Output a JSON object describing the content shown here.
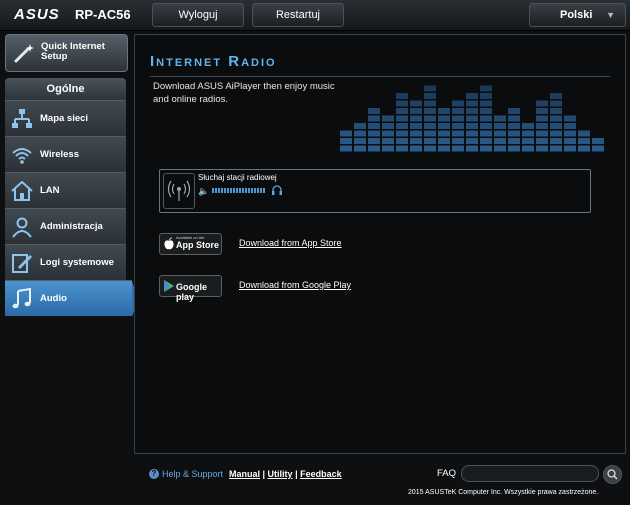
{
  "header": {
    "brand": "ASUS",
    "model": "RP-AC56",
    "logout_label": "Wyloguj",
    "restart_label": "Restartuj",
    "language": "Polski"
  },
  "sidebar": {
    "quick_setup_label": "Quick Internet Setup",
    "section_label": "Ogólne",
    "items": [
      {
        "label": "Mapa sieci",
        "icon": "network-map-icon"
      },
      {
        "label": "Wireless",
        "icon": "wireless-icon"
      },
      {
        "label": "LAN",
        "icon": "home-icon"
      },
      {
        "label": "Administracja",
        "icon": "user-admin-icon"
      },
      {
        "label": "Logi systemowe",
        "icon": "system-log-icon"
      },
      {
        "label": "Audio",
        "icon": "music-note-icon",
        "active": true
      }
    ]
  },
  "main": {
    "title": "Internet Radio",
    "description": "Download ASUS AiPlayer then enjoy music and online radios.",
    "player": {
      "label": "Słuchaj stacji radiowej",
      "volume_level": 1.0
    },
    "app_store": {
      "badge_small": "Available on the",
      "badge_big": "App Store",
      "link_label": "Download from App Store"
    },
    "google_play": {
      "badge_big": "Google play",
      "link_label": "Download from Google Play"
    }
  },
  "footer": {
    "help_label": "Help & Support",
    "manual_label": "Manual",
    "utility_label": "Utility",
    "feedback_label": "Feedback",
    "faq_label": "FAQ",
    "copyright": "2015 ASUSTeK Computer Inc. Wszystkie prawa zastrzeżone."
  },
  "colors": {
    "accent": "#4b93d0",
    "title": "#5fb6ee",
    "background": "#0d0f11"
  }
}
